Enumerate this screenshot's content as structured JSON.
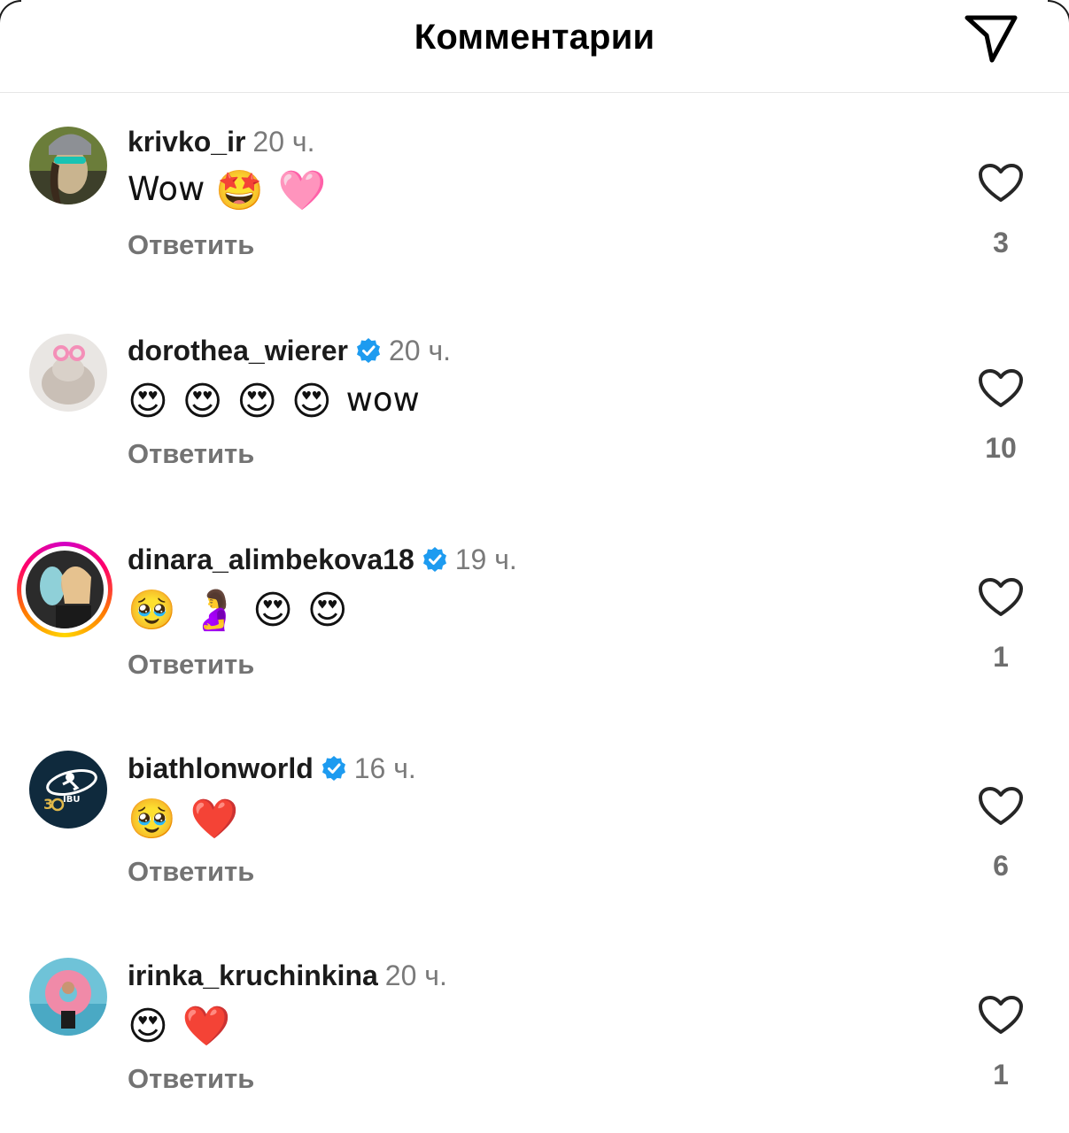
{
  "header": {
    "title": "Комментарии",
    "share_icon": "paper-plane-icon"
  },
  "comments": [
    {
      "username": "krivko_ir",
      "verified": false,
      "time": "20 ч.",
      "text": "Wow",
      "emojis": [
        "🤩",
        "🩷"
      ],
      "reply_label": "Ответить",
      "likes": "3",
      "avatar_colors": [
        "#6b7d3a",
        "#c9b48f",
        "#3d3f2a"
      ]
    },
    {
      "username": "dorothea_wierer",
      "verified": true,
      "time": "20 ч.",
      "text": "wow",
      "emojis": [
        "😍",
        "😍",
        "😍",
        "😍"
      ],
      "reply_label": "Ответить",
      "likes": "10",
      "avatar_colors": [
        "#e9e6e3",
        "#c9bfb6",
        "#f4a0c0"
      ]
    },
    {
      "username": "dinara_alimbekova18",
      "verified": true,
      "time": "19 ч.",
      "text": "",
      "emojis": [
        "🥹",
        "🤰",
        "😍",
        "😍"
      ],
      "reply_label": "Ответить",
      "likes": "1",
      "avatar_colors": [
        "#2b2b2b",
        "#d7b48a",
        "#8fd0d8"
      ],
      "has_story_ring": true
    },
    {
      "username": "biathlonworld",
      "verified": true,
      "time": "16 ч.",
      "text": "",
      "emojis": [
        "🥹",
        "❤️"
      ],
      "reply_label": "Ответить",
      "likes": "6",
      "avatar_colors": [
        "#0f2a3d",
        "#ffffff",
        "#e0b84a"
      ],
      "avatar_text": "30 IBU"
    },
    {
      "username": "irinka_kruchinkina",
      "verified": false,
      "time": "20 ч.",
      "text": "",
      "emojis": [
        "😍",
        "❤️"
      ],
      "reply_label": "Ответить",
      "likes": "1",
      "avatar_colors": [
        "#6fc3d8",
        "#f08aa8",
        "#1c1c1c"
      ]
    }
  ],
  "colors": {
    "verified_blue": "#1d9bf0",
    "secondary_text": "#737373"
  }
}
